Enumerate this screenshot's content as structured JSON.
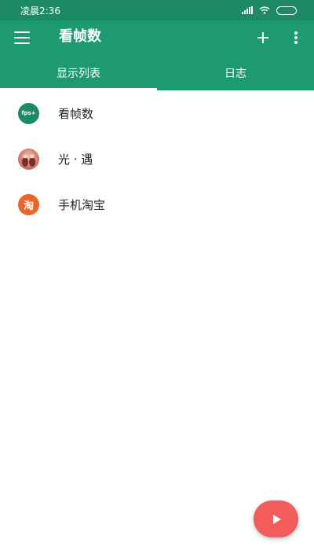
{
  "status_bar": {
    "time": "凌晨2:36"
  },
  "app_bar": {
    "title": "看帧数"
  },
  "tabs": [
    {
      "label": "显示列表",
      "active": true
    },
    {
      "label": "日志",
      "active": false
    }
  ],
  "apps": [
    {
      "name": "看帧数",
      "icon": "fps-app-icon",
      "icon_text": "fps+"
    },
    {
      "name": "光 · 遇",
      "icon": "sky-game-icon"
    },
    {
      "name": "手机淘宝",
      "icon": "taobao-icon",
      "icon_text": "淘"
    }
  ],
  "colors": {
    "primary": "#1e9a6f",
    "status_bar": "#1e8a64",
    "fab": "#f25c5c",
    "taobao": "#f0622b"
  }
}
